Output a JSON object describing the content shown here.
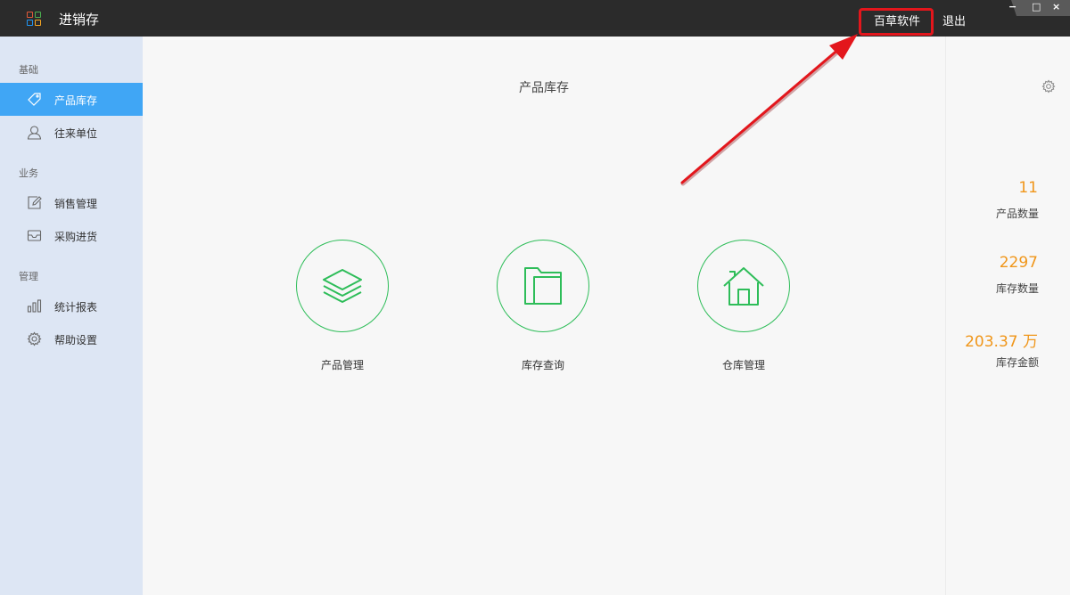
{
  "app": {
    "title": "进销存"
  },
  "header": {
    "brand_link": "百草软件",
    "logout_link": "退出"
  },
  "window_controls": {
    "minimize": "−",
    "maximize": "□",
    "close": "×"
  },
  "sidebar": {
    "sections": [
      {
        "label": "基础"
      },
      {
        "label": "业务"
      },
      {
        "label": "管理"
      }
    ],
    "items": [
      {
        "label": "产品库存",
        "icon": "tag-icon",
        "active": true
      },
      {
        "label": "往来单位",
        "icon": "user-icon",
        "active": false
      },
      {
        "label": "销售管理",
        "icon": "edit-icon",
        "active": false
      },
      {
        "label": "采购进货",
        "icon": "inbox-icon",
        "active": false
      },
      {
        "label": "统计报表",
        "icon": "bar-chart-icon",
        "active": false
      },
      {
        "label": "帮助设置",
        "icon": "gear-icon",
        "active": false
      }
    ]
  },
  "main": {
    "title": "产品库存",
    "features": [
      {
        "label": "产品管理",
        "icon": "layers-icon"
      },
      {
        "label": "库存查询",
        "icon": "folder-icon"
      },
      {
        "label": "仓库管理",
        "icon": "home-icon"
      }
    ]
  },
  "stats": [
    {
      "value": "11",
      "label": "产品数量"
    },
    {
      "value": "2297",
      "label": "库存数量"
    },
    {
      "value": "203.37 万",
      "label": "库存金额"
    }
  ],
  "colors": {
    "accent_green": "#2ebd59",
    "sidebar_active": "#40a6f5",
    "stat_orange": "#f0961a",
    "annotation_red": "#e3161c",
    "titlebar": "#2b2b2b"
  }
}
